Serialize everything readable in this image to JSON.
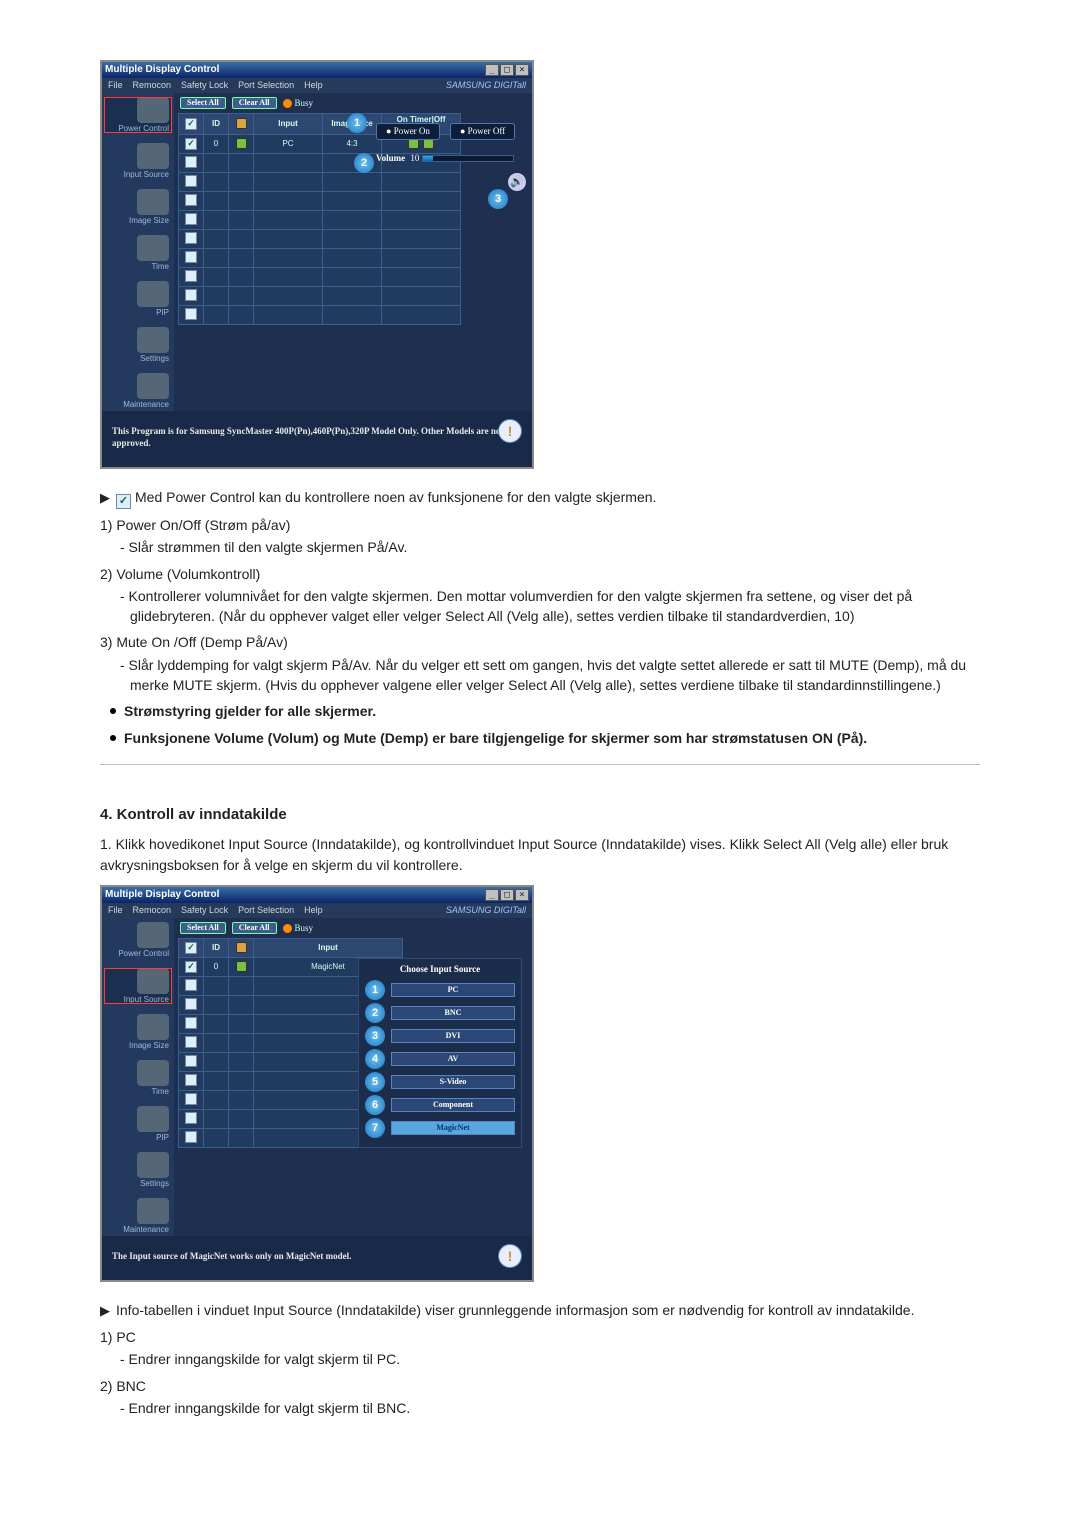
{
  "app": {
    "title": "Multiple Display Control",
    "menus": [
      "File",
      "Remocon",
      "Safety Lock",
      "Port Selection",
      "Help"
    ],
    "brand": "SAMSUNG DIGITall",
    "select_all": "Select All",
    "clear_all": "Clear All",
    "busy": "Busy",
    "power_on": "Power On",
    "power_off": "Power Off",
    "volume_label": "Volume",
    "volume_value": "10",
    "footer_text": "This Program is for Samsung SyncMaster 400P(Pn),460P(Pn),320P  Model Only. Other Models are not approved.",
    "footer_text2": "The Input source of MagicNet works only on MagicNet model.",
    "sidebar": [
      "Power Control",
      "Input Source",
      "Image Size",
      "Time",
      "PIP",
      "Settings",
      "Maintenance"
    ],
    "grid1_headers": [
      "☑",
      "ID",
      "",
      "Input",
      "Image Size",
      "On Timer|Off Timer"
    ],
    "grid1_row": [
      "0",
      "PC",
      "4:3"
    ],
    "grid2_headers": [
      "☑",
      "ID",
      "",
      "Input"
    ],
    "grid2_row": [
      "0",
      "MagicNet"
    ],
    "choose_header": "Choose Input Source",
    "choose_options": [
      "PC",
      "BNC",
      "DVI",
      "AV",
      "S-Video",
      "Component",
      "MagicNet"
    ]
  },
  "doc": {
    "intro_power": "Med Power Control kan du kontrollere noen av funksjonene for den valgte skjermen.",
    "item1_title": "Power On/Off (Strøm på/av)",
    "item1_dash": "- Slår strømmen til den valgte skjermen På/Av.",
    "item2_title": "Volume (Volumkontroll)",
    "item2_dash": "- Kontrollerer volumnivået for den valgte skjermen. Den mottar volumverdien for den valgte skjermen fra settene, og viser det på glidebryteren. (Når du opphever valget eller velger Select All (Velg alle), settes verdien tilbake til standardverdien, 10)",
    "item3_title": "Mute On /Off (Demp På/Av)",
    "item3_dash": "- Slår lyddemping for valgt skjerm På/Av. Når du velger ett sett om gangen, hvis det valgte settet allerede er satt til MUTE (Demp), må du merke MUTE skjerm. (Hvis du opphever valgene eller velger Select All (Velg alle), settes verdiene tilbake til standardinnstillingene.)",
    "bul1": "Strømstyring gjelder for alle skjermer.",
    "bul2": "Funksjonene Volume (Volum) og Mute (Demp) er bare tilgjengelige for skjermer som har strømstatusen ON (På).",
    "section4_title": "4. Kontroll av inndatakilde",
    "section4_step": "1. Klikk hovedikonet Input Source (Inndatakilde), og kontrollvinduet Input Source (Inndatakilde) vises. Klikk Select All (Velg alle) eller bruk avkrysningsboksen for å velge en skjerm du vil kontrollere.",
    "intro_input": "Info-tabellen i vinduet Input Source (Inndatakilde) viser grunnleggende informasjon som er nødvendig for kontroll av inndatakilde.",
    "pc_title": "PC",
    "pc_dash": "- Endrer inngangskilde for valgt skjerm til PC.",
    "bnc_title": "BNC",
    "bnc_dash": "- Endrer inngangskilde for valgt skjerm til BNC."
  }
}
